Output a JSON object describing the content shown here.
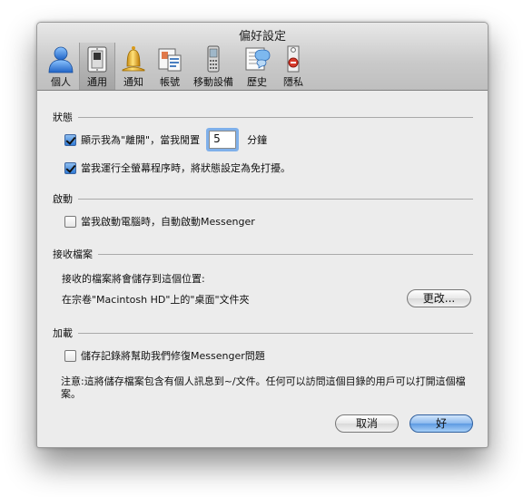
{
  "window": {
    "title": "偏好設定"
  },
  "toolbar": {
    "items": [
      {
        "label": "個人",
        "icon": "person-icon"
      },
      {
        "label": "通用",
        "icon": "switch-icon",
        "selected": true
      },
      {
        "label": "通知",
        "icon": "bell-icon"
      },
      {
        "label": "帳號",
        "icon": "accounts-icon"
      },
      {
        "label": "移動設備",
        "icon": "mobile-phone-icon"
      },
      {
        "label": "歷史",
        "icon": "history-icon"
      },
      {
        "label": "隱私",
        "icon": "privacy-icon"
      }
    ]
  },
  "status": {
    "heading": "狀態",
    "away_label": "顯示我為\"離開\"，當我閒置",
    "away_checked": true,
    "idle_minutes": "5",
    "minutes_unit": "分鐘",
    "fullscreen_label": "當我運行全螢幕程序時，將狀態設定為免打擾。",
    "fullscreen_checked": true
  },
  "startup": {
    "heading": "啟動",
    "autostart_label": "當我啟動電腦時，自動啟動Messenger",
    "autostart_checked": false
  },
  "files": {
    "heading": "接收檔案",
    "save_to_label": "接收的檔案將會儲存到這個位置:",
    "location": "在宗卷\"Macintosh HD\"上的\"桌面\"文件夾",
    "change_button": "更改..."
  },
  "extra": {
    "heading": "加載",
    "save_logs_label": "儲存記錄將幫助我們修復Messenger問題",
    "save_logs_checked": false,
    "note": "注意:這將儲存檔案包含有個人訊息到~/文件。任何可以訪問這個目錄的用戶可以打開這個檔案。"
  },
  "footer": {
    "cancel_button": "取消",
    "ok_button": "好"
  },
  "colors": {
    "accent": "#5d9ae2",
    "focus_ring": "#7fb0ea"
  }
}
